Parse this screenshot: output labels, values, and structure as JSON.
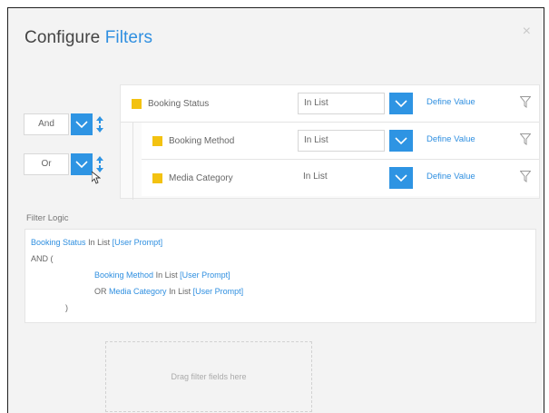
{
  "dialog": {
    "title_prefix": "Configure",
    "title_accent": "Filters",
    "close_glyph": "×"
  },
  "logic_combos": [
    {
      "value": "And"
    },
    {
      "value": "Or"
    }
  ],
  "filters": [
    {
      "field": "Booking Status",
      "operator": "In List",
      "define_label": "Define Value"
    },
    {
      "field": "Booking Method",
      "operator": "In List",
      "define_label": "Define Value"
    },
    {
      "field": "Media Category",
      "operator": "In List",
      "define_label": "Define Value"
    }
  ],
  "filter_logic": {
    "label": "Filter Logic",
    "line1": {
      "field": "Booking Status",
      "op": "In List",
      "prompt": "[User Prompt]"
    },
    "line2": "AND (",
    "line3": {
      "field": "Booking Method",
      "op": "In List",
      "prompt": "[User Prompt]"
    },
    "line4": {
      "connector": "OR",
      "field": "Media Category",
      "op": "In List",
      "prompt": "[User Prompt]"
    },
    "line5": ")"
  },
  "drop_zone": {
    "label": "Drag filter fields here"
  },
  "colors": {
    "accent": "#2e94e3",
    "field_marker": "#f3c211"
  }
}
